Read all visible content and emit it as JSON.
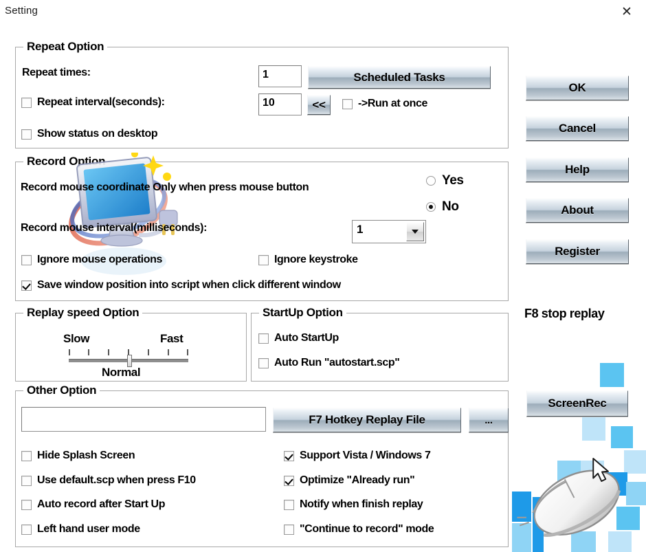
{
  "window": {
    "title": "Setting",
    "close_label": "✕"
  },
  "repeat_option": {
    "legend": "Repeat Option",
    "repeat_times_label": "Repeat times:",
    "repeat_times_value": "1",
    "scheduled_tasks_label": "Scheduled Tasks",
    "repeat_interval_label": "Repeat interval(seconds):",
    "repeat_interval_value": "10",
    "collapse_label": "<<",
    "run_at_once_label": "->Run at once",
    "show_status_label": "Show status on desktop",
    "repeat_interval_checked": false,
    "run_at_once_checked": false,
    "show_status_checked": false
  },
  "record_option": {
    "legend": "Record Option",
    "coordinate_label": "Record mouse coordinate Only when press mouse button",
    "yes_label": "Yes",
    "no_label": "No",
    "coordinate_selected": "No",
    "interval_label": "Record mouse interval(milliseconds):",
    "interval_value": "1",
    "ignore_mouse_label": "Ignore mouse operations",
    "ignore_mouse_checked": false,
    "ignore_keystroke_label": "Ignore keystroke",
    "ignore_keystroke_checked": false,
    "save_window_label": "Save window position into script when click different window",
    "save_window_checked": true
  },
  "replay_speed_option": {
    "legend": "Replay speed Option",
    "slow_label": "Slow",
    "fast_label": "Fast",
    "current_label": "Normal",
    "tick_count": 7,
    "value_index": 3
  },
  "startup_option": {
    "legend": "StartUp Option",
    "auto_startup_label": "Auto StartUp",
    "auto_startup_checked": false,
    "auto_run_label": "Auto Run \"autostart.scp\"",
    "auto_run_checked": false
  },
  "other_option": {
    "legend": "Other Option",
    "file_path_value": "",
    "file_path_placeholder": "",
    "hotkey_button_label": "F7 Hotkey Replay File",
    "browse_button_label": "...",
    "left_checks": [
      {
        "label": "Hide Splash Screen",
        "checked": false
      },
      {
        "label": "Use default.scp when press F10",
        "checked": false
      },
      {
        "label": "Auto record after Start Up",
        "checked": false
      },
      {
        "label": "Left hand user mode",
        "checked": false
      }
    ],
    "right_checks": [
      {
        "label": "Support Vista / Windows 7",
        "checked": true
      },
      {
        "label": "Optimize \"Already run\"",
        "checked": true
      },
      {
        "label": "Notify when finish replay",
        "checked": false
      },
      {
        "label": "\"Continue to record\" mode",
        "checked": false
      }
    ]
  },
  "side_buttons": {
    "ok": "OK",
    "cancel": "Cancel",
    "help": "Help",
    "about": "About",
    "register": "Register",
    "hotkey_note": "F8 stop replay",
    "screenrec": "ScreenRec"
  },
  "colors": {
    "accent_blue": "#5bc4f1",
    "accent_blue_dark": "#1e9ae8",
    "accent_blue_light": "#bfe4f9",
    "window_bg": "#ffffff",
    "group_border": "#a8a8a8"
  }
}
